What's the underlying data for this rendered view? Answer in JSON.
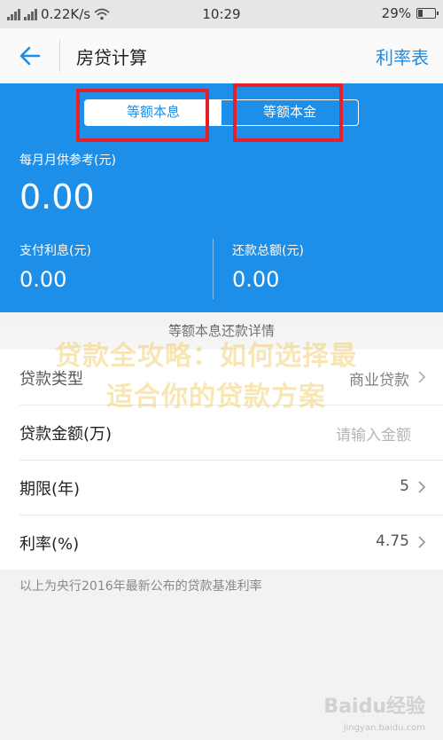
{
  "status": {
    "speed": "0.22K/s",
    "time": "10:29",
    "battery": "29%"
  },
  "nav": {
    "title": "房贷计算",
    "right_link": "利率表"
  },
  "tabs": [
    "等额本息",
    "等额本金"
  ],
  "summary": {
    "monthly_label": "每月月供参考(元)",
    "monthly_value": "0.00",
    "interest_label": "支付利息(元)",
    "interest_value": "0.00",
    "total_label": "还款总额(元)",
    "total_value": "0.00"
  },
  "detail_link": "等额本息还款详情",
  "form": {
    "loan_type_label": "贷款类型",
    "loan_type_value": "商业贷款",
    "amount_label": "贷款金额(万)",
    "amount_placeholder": "请输入金额",
    "term_label": "期限(年)",
    "term_value": "5",
    "rate_label": "利率(%)",
    "rate_value": "4.75"
  },
  "footnote": "以上为央行2016年最新公布的贷款基准利率",
  "watermark": {
    "line1": "贷款全攻略：如何选择最",
    "line2": "适合你的贷款方案",
    "logo": "Baidu经验",
    "url": "jingyan.baidu.com"
  },
  "colors": {
    "primary": "#1e8fe8",
    "highlight": "#e5202a"
  }
}
